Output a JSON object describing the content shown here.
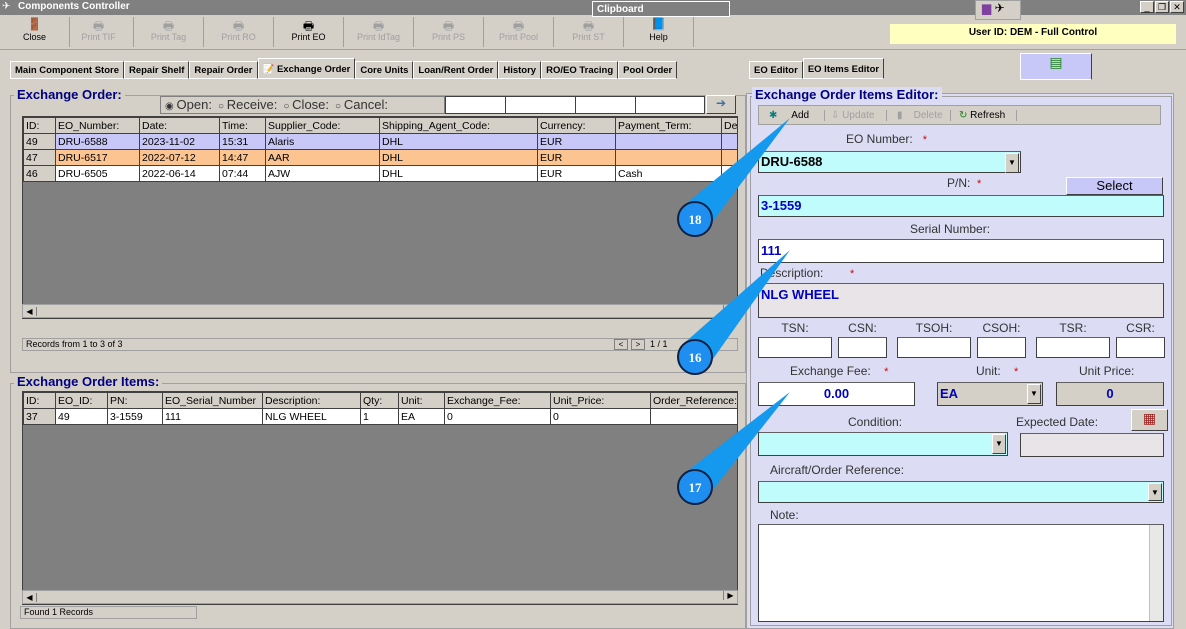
{
  "window": {
    "title": "Components Controller",
    "clipboard": "Clipboard",
    "user": "User ID: DEM - Full Control"
  },
  "toolbar": [
    {
      "label": "Close",
      "icon": "door-exit-icon",
      "enabled": true
    },
    {
      "label": "Print TIF",
      "icon": "printer-icon",
      "enabled": false
    },
    {
      "label": "Print Tag",
      "icon": "printer-icon",
      "enabled": false
    },
    {
      "label": "Print RO",
      "icon": "printer-icon",
      "enabled": false
    },
    {
      "label": "Print EO",
      "icon": "printer-icon",
      "enabled": true
    },
    {
      "label": "Print IdTag",
      "icon": "printer-icon",
      "enabled": false
    },
    {
      "label": "Print PS",
      "icon": "printer-icon",
      "enabled": false
    },
    {
      "label": "Print Pool",
      "icon": "printer-icon",
      "enabled": false
    },
    {
      "label": "Print ST",
      "icon": "printer-icon",
      "enabled": false
    },
    {
      "label": "Help",
      "icon": "help-book-icon",
      "enabled": true
    }
  ],
  "tabs": [
    "Main Component Store",
    "Repair Shelf",
    "Repair Order",
    "Exchange Order",
    "Core Units",
    "Loan/Rent Order",
    "History",
    "RO/EO Tracing",
    "Pool Order"
  ],
  "right_tabs": [
    "EO Editor",
    "EO Items Editor"
  ],
  "exchange_order": {
    "title": "Exchange Order:",
    "filters": [
      "Open:",
      "Receive:",
      "Close:",
      "Cancel:"
    ],
    "selected_filter": "Open:",
    "columns": [
      "ID:",
      "EO_Number:",
      "Date:",
      "Time:",
      "Supplier_Code:",
      "Shipping_Agent_Code:",
      "Currency:",
      "Payment_Term:",
      "De"
    ],
    "rows": [
      [
        "49",
        "DRU-6588",
        "2023-11-02",
        "15:31",
        "Alaris",
        "DHL",
        "EUR",
        "",
        ""
      ],
      [
        "47",
        "DRU-6517",
        "2022-07-12",
        "14:47",
        "AAR",
        "DHL",
        "EUR",
        "",
        ""
      ],
      [
        "46",
        "DRU-6505",
        "2022-06-14",
        "07:44",
        "AJW",
        "DHL",
        "EUR",
        "Cash",
        ""
      ]
    ],
    "status": "Records from 1 to 3 of 3",
    "prev": "<",
    "next": ">",
    "page": "1 / 1"
  },
  "items": {
    "title": "Exchange Order Items:",
    "columns": [
      "ID:",
      "EO_ID:",
      "PN:",
      "EO_Serial_Number",
      "Description:",
      "Qty:",
      "Unit:",
      "Exchange_Fee:",
      "Unit_Price:",
      "Order_Reference:"
    ],
    "rows": [
      [
        "37",
        "49",
        "3-1559",
        "111",
        "NLG WHEEL",
        "1",
        "EA",
        "0",
        "0",
        ""
      ]
    ],
    "status": "Found 1 Records"
  },
  "editor": {
    "title": "Exchange Order Items Editor:",
    "add": "Add",
    "update": "Update",
    "delete": "Delete",
    "refresh": "Refresh",
    "eo_number_label": "EO Number:",
    "eo_number": "DRU-6588",
    "pn_label": "P/N:",
    "pn": "3-1559",
    "select": "Select",
    "serial_label": "Serial Number:",
    "serial": "111",
    "desc_label": "Description:",
    "desc": "NLG WHEEL",
    "tsn": "TSN:",
    "csn": "CSN:",
    "tsoh": "TSOH:",
    "csoh": "CSOH:",
    "tsr": "TSR:",
    "csr": "CSR:",
    "fee_label": "Exchange Fee:",
    "fee": "0.00",
    "unit_label": "Unit:",
    "unit": "EA",
    "price_label": "Unit Price:",
    "price": "0",
    "condition_label": "Condition:",
    "expected_label": "Expected Date:",
    "ref_label": "Aircraft/Order Reference:",
    "note_label": "Note:",
    "req": "*"
  },
  "callouts": [
    "18",
    "16",
    "17"
  ]
}
